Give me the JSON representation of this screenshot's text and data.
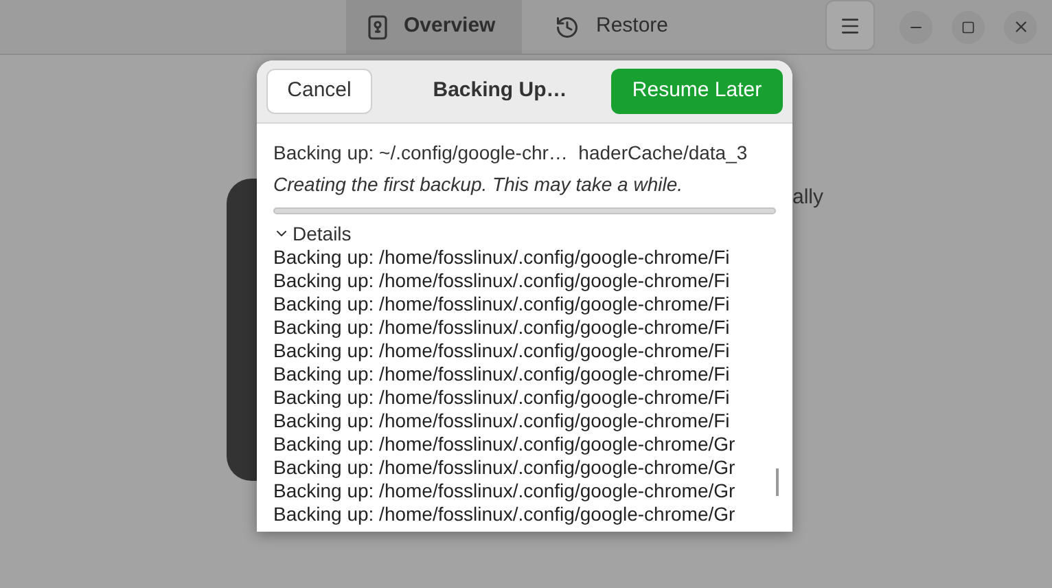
{
  "header": {
    "tabs": [
      {
        "label": "Overview",
        "selected": true
      },
      {
        "label": "Restore",
        "selected": false
      }
    ]
  },
  "background_text": "ally",
  "dialog": {
    "title": "Backing Up…",
    "cancel": "Cancel",
    "confirm": "Resume Later",
    "current_file": "Backing up: ~/.config/google-chr…  haderCache/data_3",
    "note": "Creating the first backup.  This may take a while.",
    "details": {
      "label": "Details",
      "expanded": true,
      "lines": [
        "Backing up: /home/fosslinux/.config/google-chrome/Fi",
        "Backing up: /home/fosslinux/.config/google-chrome/Fi",
        "Backing up: /home/fosslinux/.config/google-chrome/Fi",
        "Backing up: /home/fosslinux/.config/google-chrome/Fi",
        "Backing up: /home/fosslinux/.config/google-chrome/Fi",
        "Backing up: /home/fosslinux/.config/google-chrome/Fi",
        "Backing up: /home/fosslinux/.config/google-chrome/Fi",
        "Backing up: /home/fosslinux/.config/google-chrome/Fi",
        "Backing up: /home/fosslinux/.config/google-chrome/Gr",
        "Backing up: /home/fosslinux/.config/google-chrome/Gr",
        "Backing up: /home/fosslinux/.config/google-chrome/Gr",
        "Backing up: /home/fosslinux/.config/google-chrome/Gr"
      ]
    }
  }
}
